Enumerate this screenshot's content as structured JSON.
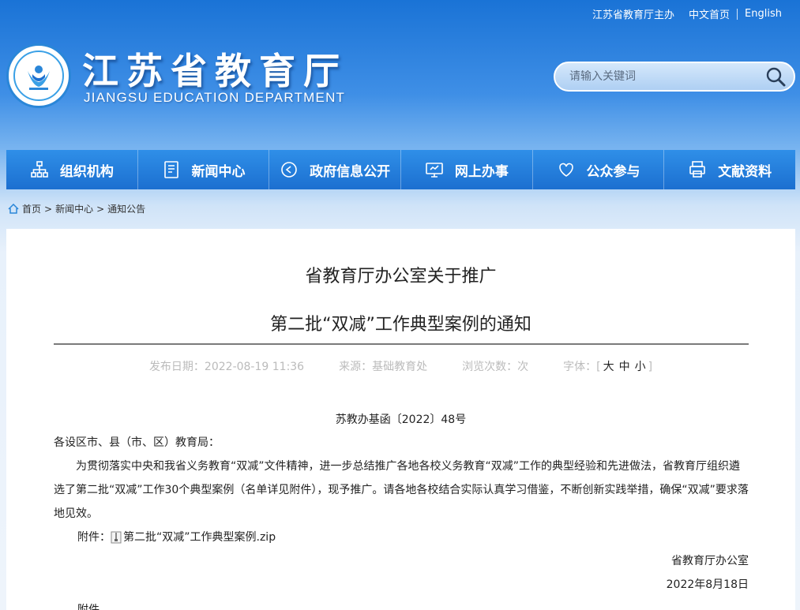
{
  "top_links": {
    "host": "江苏省教育厅主办",
    "cn_home": "中文首页",
    "english": "English"
  },
  "header": {
    "title_cn": "江苏省教育厅",
    "title_en": "JIANGSU EDUCATION DEPARTMENT"
  },
  "search": {
    "placeholder": "请输入关键词"
  },
  "nav": [
    {
      "label": "组织机构",
      "icon": "org-chart-icon"
    },
    {
      "label": "新闻中心",
      "icon": "document-icon"
    },
    {
      "label": "政府信息公开",
      "icon": "play-circle-icon"
    },
    {
      "label": "网上办事",
      "icon": "monitor-icon"
    },
    {
      "label": "公众参与",
      "icon": "heart-icon"
    },
    {
      "label": "文献资料",
      "icon": "printer-icon"
    }
  ],
  "breadcrumb": {
    "home": "首页",
    "news": "新闻中心",
    "notice": "通知公告",
    "sep": ">"
  },
  "article": {
    "title_line1": "省教育厅办公室关于推广",
    "title_line2": "第二批“双减”工作典型案例的通知",
    "publish_date": "发布日期：2022-08-19 11:36",
    "source": "来源：基础教育处",
    "views": "浏览次数：次",
    "font_label": "字体：[",
    "font_large": "大",
    "font_medium": "中",
    "font_small": "小",
    "font_close": "]",
    "doc_number": "苏教办基函〔2022〕48号",
    "salutation": "各设区市、县（市、区）教育局：",
    "paragraph": "为贯彻落实中央和我省义务教育“双减”文件精神，进一步总结推广各地各校义务教育“双减”工作的典型经验和先进做法，省教育厅组织遴选了第二批“双减”工作30个典型案例（名单详见附件），现予推广。请各地各校结合实际认真学习借鉴，不断创新实践举措，确保“双减”要求落地见效。",
    "attachment_label": "附件：",
    "attachment_file": "第二批“双减”工作典型案例.zip",
    "signature": "省教育厅办公室",
    "date": "2022年8月18日",
    "trailing": "附件"
  }
}
